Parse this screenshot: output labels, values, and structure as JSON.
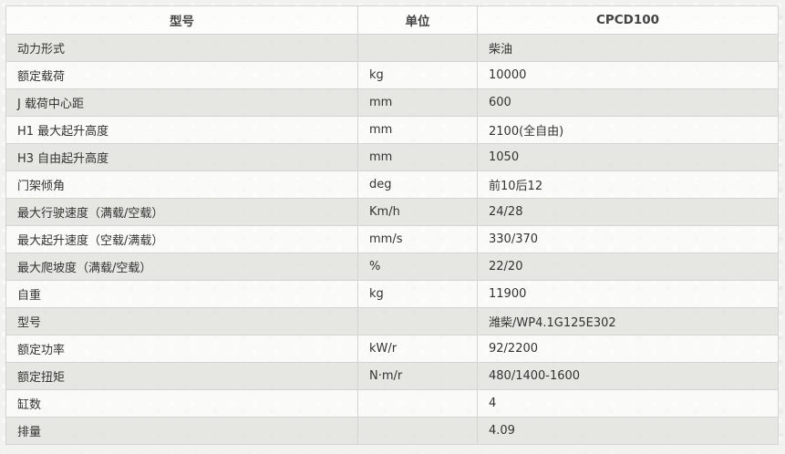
{
  "header": {
    "col_model": "型号",
    "col_unit": "单位",
    "col_value": "CPCD100"
  },
  "rows": [
    {
      "label": "动力形式",
      "unit": "",
      "value": "柴油"
    },
    {
      "label": "额定载荷",
      "unit": "kg",
      "value": "10000"
    },
    {
      "label": "J 载荷中心距",
      "unit": "mm",
      "value": "600"
    },
    {
      "label": "H1 最大起升高度",
      "unit": "mm",
      "value": "2100(全自由)"
    },
    {
      "label": "H3 自由起升高度",
      "unit": "mm",
      "value": "1050"
    },
    {
      "label": "门架倾角",
      "unit": "deg",
      "value": "前10后12"
    },
    {
      "label": "最大行驶速度（满载/空载）",
      "unit": "Km/h",
      "value": "24/28"
    },
    {
      "label": "最大起升速度（空载/满载）",
      "unit": "mm/s",
      "value": "330/370"
    },
    {
      "label": "最大爬坡度（满载/空载）",
      "unit": "%",
      "value": "22/20"
    },
    {
      "label": "自重",
      "unit": "kg",
      "value": "11900"
    },
    {
      "label": "型号",
      "unit": "",
      "value": "潍柴/WP4.1G125E302"
    },
    {
      "label": "额定功率",
      "unit": "kW/r",
      "value": "92/2200"
    },
    {
      "label": "额定扭矩",
      "unit": "N·m/r",
      "value": "480/1400-1600"
    },
    {
      "label": "缸数",
      "unit": "",
      "value": "4"
    },
    {
      "label": "排量",
      "unit": "",
      "value": "4.09"
    }
  ]
}
